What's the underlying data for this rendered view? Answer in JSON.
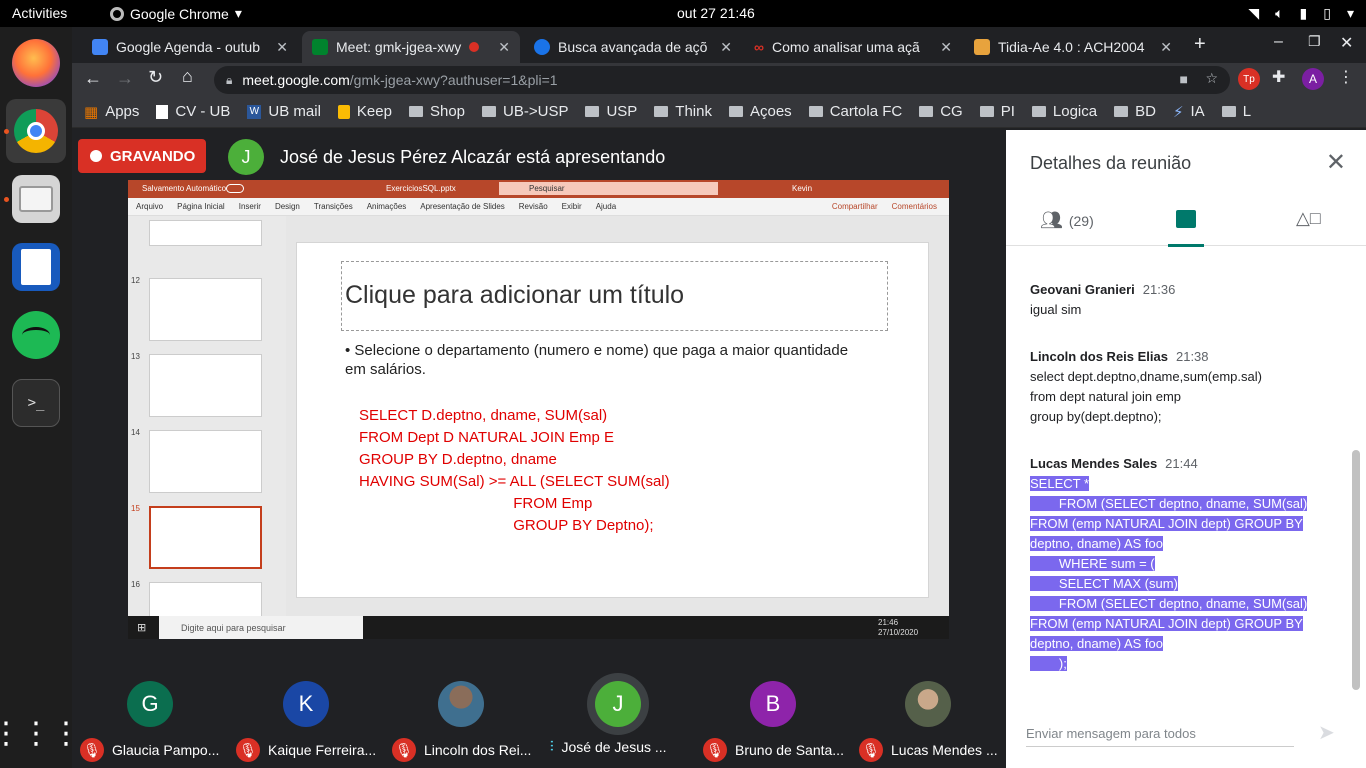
{
  "topbar": {
    "activities": "Activities",
    "app": "Google Chrome",
    "clock": "out 27  21:46"
  },
  "tabs": [
    {
      "label": "Google Agenda - outub",
      "color": "#4285f4"
    },
    {
      "label": "Meet: gmk-jgea-xwy",
      "color": "#00832d"
    },
    {
      "label": "Busca avançada de açõ",
      "color": "#1a73e8"
    },
    {
      "label": "Como analisar uma açã",
      "color": "#d93025"
    },
    {
      "label": "Tidia-Ae 4.0 : ACH2004",
      "color": "#e8a33d"
    }
  ],
  "url": {
    "host": "meet.google.com",
    "path": "/gmk-jgea-xwy?authuser=1&pli=1"
  },
  "profile_letter": "A",
  "bookmarks": [
    "Apps",
    "CV - UB",
    "UB mail",
    "Keep",
    "Shop",
    "UB->USP",
    "USP",
    "Think",
    "Açoes",
    "Cartola FC",
    "CG",
    "PI",
    "Logica",
    "BD",
    "IA",
    "L"
  ],
  "meet": {
    "recording": "GRAVANDO",
    "presenter_initial": "J",
    "presenter_text": "José de Jesus Pérez Alcazár está apresentando"
  },
  "screen": {
    "pp_autosave": "Salvamento Automático",
    "pp_filename": "ExerciciosSQL.pptx",
    "pp_search": "Pesquisar",
    "pp_user": "Kevin",
    "ribbon": [
      "Arquivo",
      "Página Inicial",
      "Inserir",
      "Design",
      "Transições",
      "Animações",
      "Apresentação de Slides",
      "Revisão",
      "Exibir",
      "Ajuda"
    ],
    "share": "Compartilhar",
    "comments": "Comentários",
    "thumb_numbers": [
      "12",
      "13",
      "14",
      "15",
      "16"
    ],
    "slide_title": "Clique para adicionar um título",
    "slide_bullet": "• Selecione o  departamento (numero e nome) que paga a maior quantidade em salários.",
    "slide_sql": "SELECT D.deptno, dname, SUM(sal)\nFROM Dept D NATURAL JOIN Emp E\nGROUP BY D.deptno, dname\nHAVING SUM(Sal) >= ALL (SELECT SUM(sal)\n                                     FROM Emp\n                                     GROUP BY Deptno);",
    "taskbar_search": "Digite aqui para pesquisar",
    "taskbar_time": "21:46",
    "taskbar_date": "27/10/2020"
  },
  "participants": [
    {
      "initial": "G",
      "name": "Glaucia Pampo...",
      "color": "#0b6e4f"
    },
    {
      "initial": "K",
      "name": "Kaique Ferreira...",
      "color": "#1a47a5"
    },
    {
      "initial": "",
      "name": "Lincoln dos Rei...",
      "color": "#8a6d5a"
    },
    {
      "initial": "J",
      "name": "José de Jesus ...",
      "color": "#4caf3a"
    },
    {
      "initial": "B",
      "name": "Bruno de Santa...",
      "color": "#8e24aa"
    },
    {
      "initial": "",
      "name": "Lucas Mendes ...",
      "color": "#55604a"
    }
  ],
  "panel": {
    "title": "Detalhes da reunião",
    "people_count": "(29)",
    "messages": [
      {
        "sender": "Geovani Granieri",
        "time": "21:36",
        "text": "igual sim"
      },
      {
        "sender": "Lincoln dos Reis Elias",
        "time": "21:38",
        "text": "select dept.deptno,dname,sum(emp.sal)\nfrom dept natural join emp\ngroup by(dept.deptno);"
      },
      {
        "sender": "Lucas Mendes Sales",
        "time": "21:44",
        "text": "SELECT *\n        FROM (SELECT deptno, dname, SUM(sal)\nFROM (emp NATURAL JOIN dept) GROUP BY\ndeptno, dname) AS foo\n        WHERE sum = (\n        SELECT MAX (sum)\n        FROM (SELECT deptno, dname, SUM(sal)\nFROM (emp NATURAL JOIN dept) GROUP BY\ndeptno, dname) AS foo\n        );"
      }
    ],
    "input_placeholder": "Enviar mensagem para todos"
  }
}
